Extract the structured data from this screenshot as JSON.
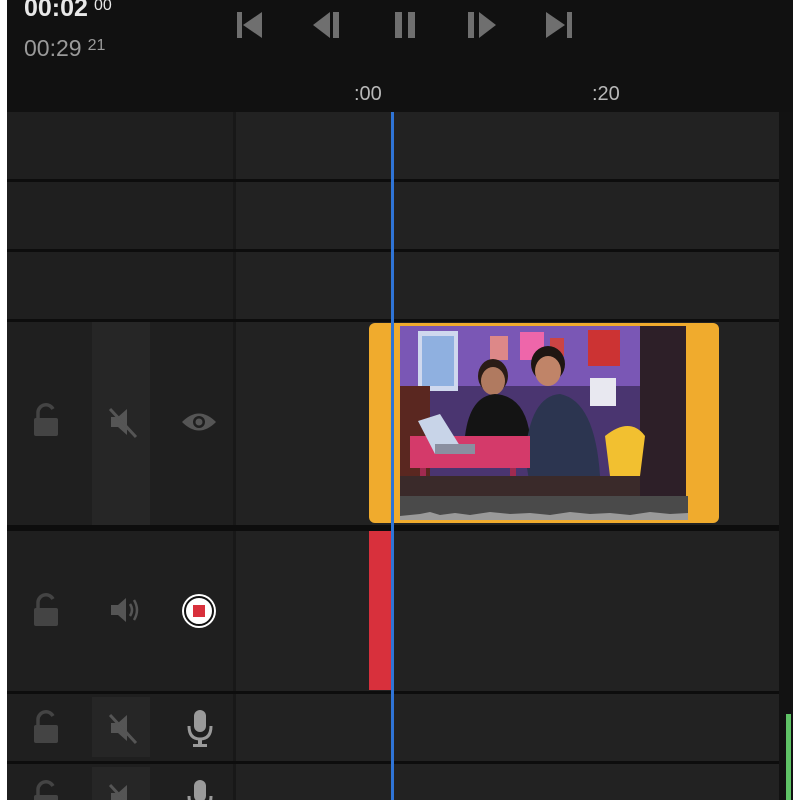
{
  "timecode": {
    "current_main": "00:02",
    "current_frames": "00",
    "total_main": "00:29",
    "total_frames": "21"
  },
  "transport": {
    "buttons": [
      "skip-to-start",
      "step-back",
      "pause",
      "step-forward",
      "skip-to-end"
    ]
  },
  "ruler": {
    "labels": [
      ":00",
      ":20"
    ]
  },
  "tracks": {
    "video": {
      "lock_icon": "lock-open-icon",
      "mute_icon": "speaker-muted-icon",
      "visibility_icon": "eye-icon"
    },
    "audio_recording": {
      "lock_icon": "lock-open-icon",
      "volume_icon": "speaker-icon",
      "record_icon": "record-stop-icon"
    },
    "audio_1": {
      "lock_icon": "lock-open-icon",
      "mute_icon": "speaker-muted-icon",
      "mic_icon": "microphone-icon"
    },
    "audio_2": {
      "lock_icon": "lock-open-icon",
      "mute_icon": "speaker-muted-icon",
      "mic_icon": "microphone-icon"
    }
  },
  "colors": {
    "clip_border": "#f0ab2d",
    "playhead": "#2f74d6",
    "recording": "#d8303c",
    "level_meter": "#5fc266"
  }
}
